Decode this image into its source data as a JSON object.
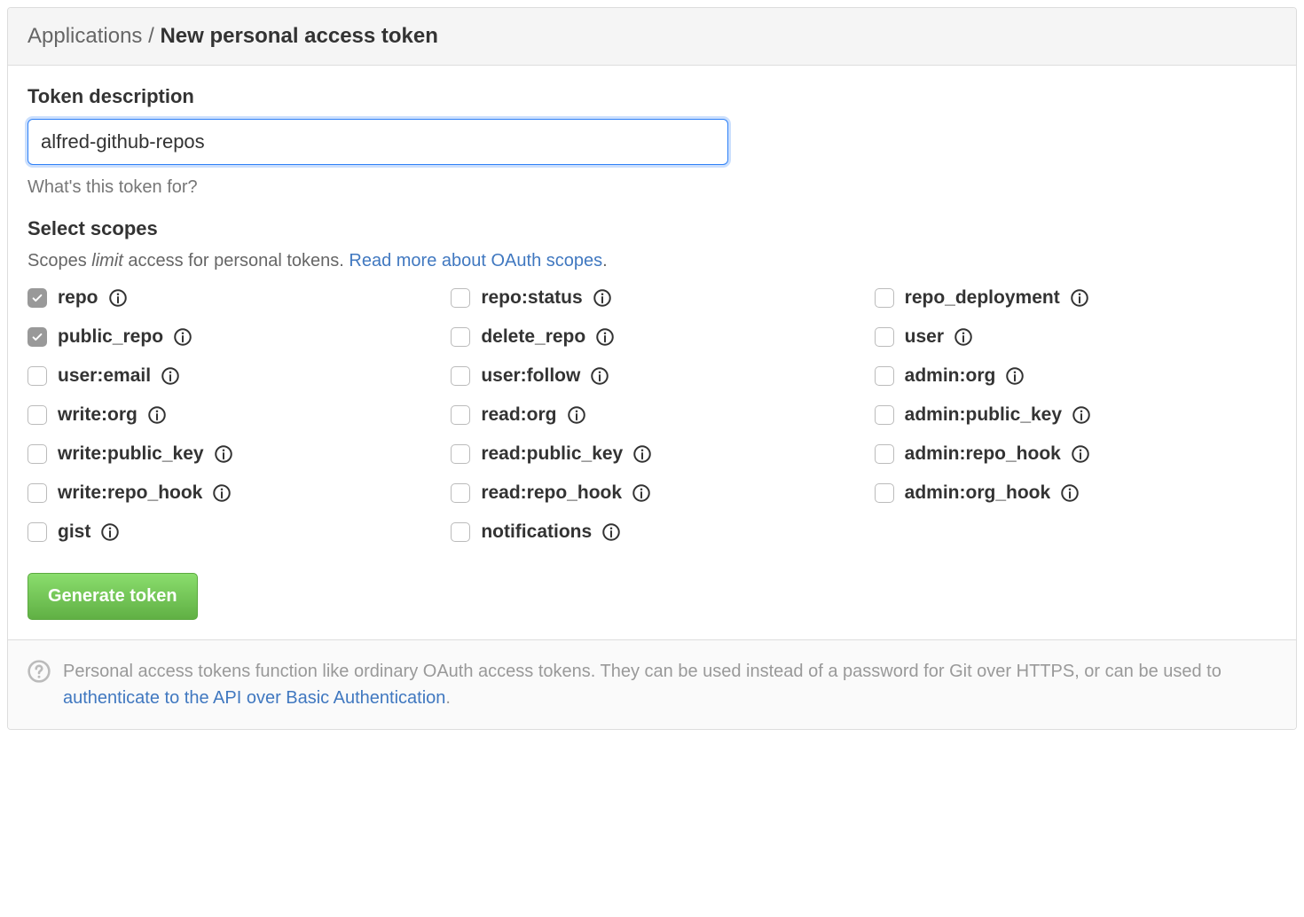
{
  "header": {
    "breadcrumb_root": "Applications",
    "breadcrumb_sep": " / ",
    "breadcrumb_current": "New personal access token"
  },
  "token": {
    "label": "Token description",
    "value": "alfred-github-repos",
    "hint": "What's this token for?"
  },
  "scopes": {
    "title": "Select scopes",
    "intro_prefix": "Scopes ",
    "intro_italic": "limit",
    "intro_suffix": " access for personal tokens. ",
    "intro_link": "Read more about OAuth scopes",
    "intro_period": ".",
    "items": [
      {
        "name": "repo",
        "checked": true
      },
      {
        "name": "repo:status",
        "checked": false
      },
      {
        "name": "repo_deployment",
        "checked": false
      },
      {
        "name": "public_repo",
        "checked": true
      },
      {
        "name": "delete_repo",
        "checked": false
      },
      {
        "name": "user",
        "checked": false
      },
      {
        "name": "user:email",
        "checked": false
      },
      {
        "name": "user:follow",
        "checked": false
      },
      {
        "name": "admin:org",
        "checked": false
      },
      {
        "name": "write:org",
        "checked": false
      },
      {
        "name": "read:org",
        "checked": false
      },
      {
        "name": "admin:public_key",
        "checked": false
      },
      {
        "name": "write:public_key",
        "checked": false
      },
      {
        "name": "read:public_key",
        "checked": false
      },
      {
        "name": "admin:repo_hook",
        "checked": false
      },
      {
        "name": "write:repo_hook",
        "checked": false
      },
      {
        "name": "read:repo_hook",
        "checked": false
      },
      {
        "name": "admin:org_hook",
        "checked": false
      },
      {
        "name": "gist",
        "checked": false
      },
      {
        "name": "notifications",
        "checked": false
      }
    ]
  },
  "actions": {
    "generate_label": "Generate token"
  },
  "footer": {
    "text_before": "Personal access tokens function like ordinary OAuth access tokens. They can be used instead of a password for Git over HTTPS, or can be used to ",
    "link_text": "authenticate to the API over Basic Authentication",
    "text_after": "."
  }
}
